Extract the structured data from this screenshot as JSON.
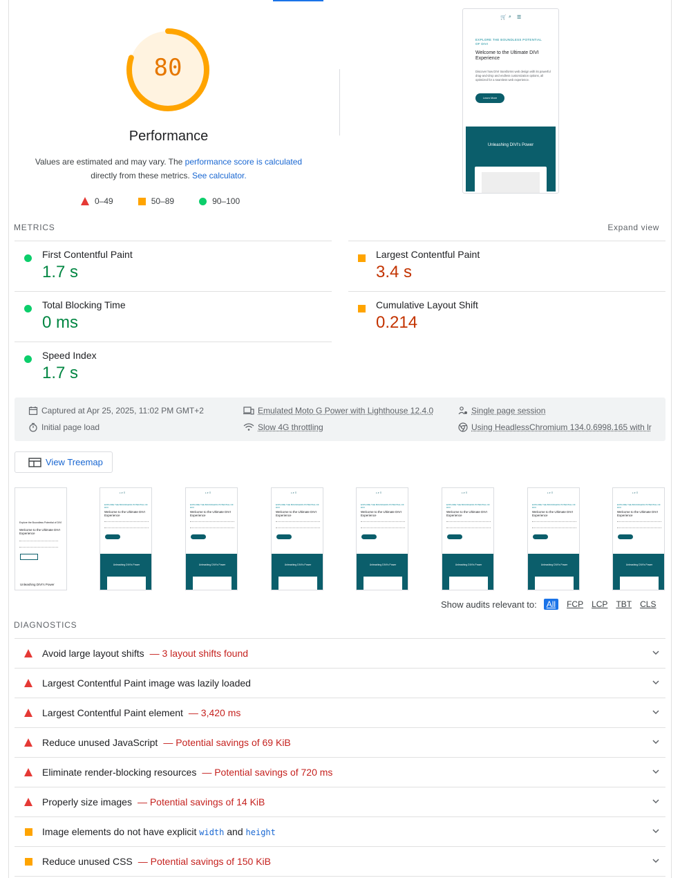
{
  "score": {
    "value": "80",
    "fraction": 0.8,
    "label": "Performance"
  },
  "description": {
    "part1": "Values are estimated and may vary. The ",
    "link1": "performance score is calculated",
    "part2": " directly from these metrics. ",
    "link2": "See calculator."
  },
  "legend": {
    "fail": "0–49",
    "average": "50–89",
    "pass": "90–100"
  },
  "screenshot": {
    "kicker": "EXPLORE THE BOUNDLESS POTENTIAL OF DIVI",
    "heading": "Welcome to the Ultimate DIVI Experience",
    "body": "Discover how DIVI transforms web design with its powerful drag-and-drop and endless customization options, all optimized for a seamless web experience.",
    "button": "Learn More",
    "band": "Unleashing DIVI's Power"
  },
  "metrics": {
    "header": "METRICS",
    "expand": "Expand view",
    "fcp": {
      "label": "First Contentful Paint",
      "value": "1.7 s"
    },
    "lcp": {
      "label": "Largest Contentful Paint",
      "value": "3.4 s"
    },
    "tbt": {
      "label": "Total Blocking Time",
      "value": "0 ms"
    },
    "cls": {
      "label": "Cumulative Layout Shift",
      "value": "0.214"
    },
    "si": {
      "label": "Speed Index",
      "value": "1.7 s"
    }
  },
  "info": {
    "captured": "Captured at Apr 25, 2025, 11:02 PM GMT+2",
    "initial": "Initial page load",
    "emulated": "Emulated Moto G Power with Lighthouse 12.4.0",
    "throttling": "Slow 4G throttling",
    "session": "Single page session",
    "browser": "Using HeadlessChromium 134.0.6998.165 with lr"
  },
  "treemap": "View Treemap",
  "filmstrip": {
    "first_heading": "Welcome to the Ultimate DIVI Experience",
    "first_kicker": "Explore the Boundless Potential of DIVI",
    "first_band": "Unleashing DIVI's Power",
    "heading": "Welcome to the Ultimate DIVI Experience",
    "band": "Unleashing DIVI's Power"
  },
  "filters": {
    "label": "Show audits relevant to:",
    "all": "All",
    "fcp": "FCP",
    "lcp": "LCP",
    "tbt": "TBT",
    "cls": "CLS"
  },
  "diagnostics": {
    "header": "DIAGNOSTICS",
    "items": [
      {
        "title": "Avoid large layout shifts",
        "display": "3 layout shifts found",
        "rating": "fail"
      },
      {
        "title": "Largest Contentful Paint image was lazily loaded",
        "display": "",
        "rating": "fail"
      },
      {
        "title": "Largest Contentful Paint element",
        "display": "3,420 ms",
        "rating": "fail"
      },
      {
        "title": "Reduce unused JavaScript",
        "display": "Potential savings of 69 KiB",
        "rating": "fail"
      },
      {
        "title": "Eliminate render-blocking resources",
        "display": "Potential savings of 720 ms",
        "rating": "fail"
      },
      {
        "title": "Properly size images",
        "display": "Potential savings of 14 KiB",
        "rating": "fail"
      },
      {
        "title_pre": "Image elements do not have explicit ",
        "code1": "width",
        "title_mid": " and ",
        "code2": "height",
        "rating": "average"
      },
      {
        "title": "Reduce unused CSS",
        "display": "Potential savings of 150 KiB",
        "rating": "average"
      }
    ]
  },
  "colors": {
    "fail": "#e53935",
    "average": "#ffa400",
    "pass": "#0cce6b",
    "link": "#1967d2"
  }
}
